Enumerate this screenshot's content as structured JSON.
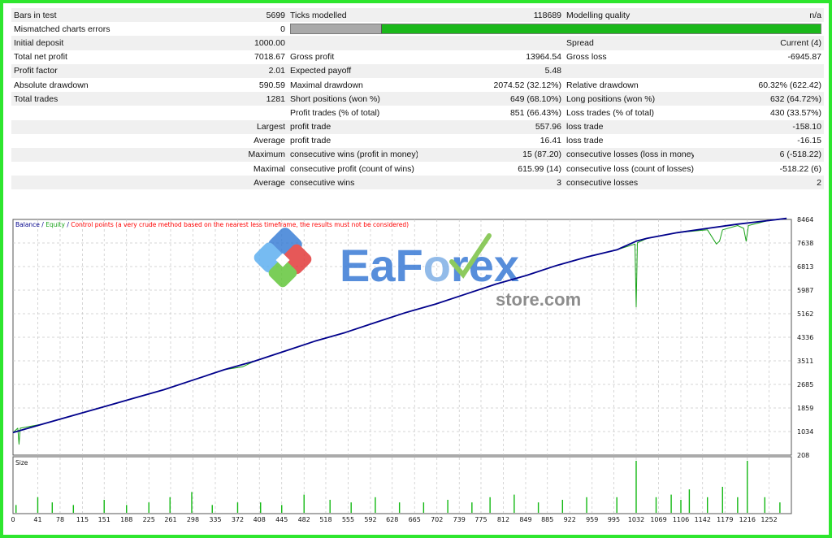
{
  "stats": [
    [
      {
        "label": "Bars in test",
        "value": "5699"
      },
      {
        "label": "Ticks modelled",
        "value": "118689"
      },
      {
        "label": "Modelling quality",
        "value": "n/a"
      }
    ],
    [
      {
        "label": "Mismatched charts errors",
        "value": "0"
      },
      null,
      null
    ],
    [
      {
        "label": "Initial deposit",
        "value": "1000.00"
      },
      null,
      {
        "label": "Spread",
        "value": "Current (4)"
      }
    ],
    [
      {
        "label": "Total net profit",
        "value": "7018.67"
      },
      {
        "label": "Gross profit",
        "value": "13964.54"
      },
      {
        "label": "Gross loss",
        "value": "-6945.87"
      }
    ],
    [
      {
        "label": "Profit factor",
        "value": "2.01"
      },
      {
        "label": "Expected payoff",
        "value": "5.48"
      },
      null
    ],
    [
      {
        "label": "Absolute drawdown",
        "value": "590.59"
      },
      {
        "label": "Maximal drawdown",
        "value": "2074.52 (32.12%)"
      },
      {
        "label": "Relative drawdown",
        "value": "60.32% (622.42)"
      }
    ],
    [
      {
        "label": "Total trades",
        "value": "1281"
      },
      {
        "label": "Short positions (won %)",
        "value": "649 (68.10%)"
      },
      {
        "label": "Long positions (won %)",
        "value": "632 (64.72%)"
      }
    ],
    [
      {
        "label": "",
        "value": ""
      },
      {
        "label": "Profit trades (% of total)",
        "value": "851 (66.43%)"
      },
      {
        "label": "Loss trades (% of total)",
        "value": "430 (33.57%)"
      }
    ],
    [
      {
        "label": "",
        "value": "Largest"
      },
      {
        "label": "profit trade",
        "value": "557.96"
      },
      {
        "label": "loss trade",
        "value": "-158.10"
      }
    ],
    [
      {
        "label": "",
        "value": "Average"
      },
      {
        "label": "profit trade",
        "value": "16.41"
      },
      {
        "label": "loss trade",
        "value": "-16.15"
      }
    ],
    [
      {
        "label": "",
        "value": "Maximum"
      },
      {
        "label": "consecutive wins (profit in money)",
        "value": "15 (87.20)"
      },
      {
        "label": "consecutive losses (loss in money)",
        "value": "6 (-518.22)"
      }
    ],
    [
      {
        "label": "",
        "value": "Maximal"
      },
      {
        "label": "consecutive profit (count of wins)",
        "value": "615.99 (14)"
      },
      {
        "label": "consecutive loss (count of losses)",
        "value": "-518.22 (6)"
      }
    ],
    [
      {
        "label": "",
        "value": "Average"
      },
      {
        "label": "consecutive wins",
        "value": "3"
      },
      {
        "label": "consecutive losses",
        "value": "2"
      }
    ]
  ],
  "quality_bar": {
    "fraction_gray": 0.17
  },
  "watermark": {
    "main_blue": "EaF",
    "main_o": "o",
    "main_rest": "rex",
    "sub": "store.com"
  },
  "colors": {
    "balance": "#00008b",
    "equity": "#1aa31a",
    "control": "#ff0000",
    "size_bars": "#12b812",
    "grid": "#c6c6c6"
  },
  "chart_data": {
    "type": "line",
    "legend": {
      "balance": "Balance",
      "sep1": " / ",
      "equity": "Equity",
      "sep2": " / ",
      "control": "Control points (a very crude method based on the nearest less timeframe, the results must not be considered)"
    },
    "ylim": [
      208,
      8464
    ],
    "y_ticks": [
      "8464",
      "7638",
      "6813",
      "5987",
      "5162",
      "4336",
      "3511",
      "2685",
      "1859",
      "1034",
      "208"
    ],
    "xlim": [
      0,
      1289
    ],
    "x_ticks": [
      "0",
      "41",
      "78",
      "115",
      "151",
      "188",
      "225",
      "261",
      "298",
      "335",
      "372",
      "408",
      "445",
      "482",
      "518",
      "555",
      "592",
      "628",
      "665",
      "702",
      "739",
      "775",
      "812",
      "849",
      "885",
      "922",
      "959",
      "995",
      "1032",
      "1069",
      "1106",
      "1142",
      "1179",
      "1216",
      "1252"
    ],
    "series": [
      {
        "name": "Balance",
        "x": [
          0,
          50,
          100,
          150,
          200,
          250,
          300,
          350,
          400,
          450,
          500,
          550,
          600,
          650,
          700,
          750,
          800,
          850,
          900,
          950,
          1000,
          1032,
          1050,
          1100,
          1150,
          1200,
          1250,
          1281
        ],
        "y": [
          1000,
          1300,
          1600,
          1900,
          2200,
          2500,
          2850,
          3200,
          3500,
          3850,
          4200,
          4500,
          4850,
          5200,
          5500,
          5850,
          6200,
          6500,
          6850,
          7150,
          7400,
          7700,
          7800,
          8000,
          8150,
          8300,
          8420,
          8500
        ]
      },
      {
        "name": "Equity",
        "x": [
          0,
          8,
          10,
          12,
          50,
          100,
          150,
          200,
          250,
          300,
          350,
          380,
          400,
          450,
          500,
          550,
          600,
          650,
          700,
          750,
          800,
          850,
          900,
          950,
          1000,
          1030,
          1032,
          1034,
          1040,
          1050,
          1100,
          1150,
          1165,
          1170,
          1175,
          1200,
          1210,
          1214,
          1218,
          1250,
          1281
        ],
        "y": [
          1000,
          1150,
          590,
          1150,
          1300,
          1600,
          1900,
          2200,
          2500,
          2850,
          3200,
          3300,
          3500,
          3850,
          4200,
          4500,
          4850,
          5200,
          5500,
          5850,
          6200,
          6500,
          6850,
          7150,
          7400,
          7600,
          5400,
          7650,
          7700,
          7800,
          8000,
          8100,
          7600,
          7700,
          8100,
          8250,
          8150,
          7700,
          8250,
          8420,
          8500
        ]
      }
    ],
    "size_panel": {
      "title": "Size",
      "x": [
        5,
        41,
        65,
        100,
        151,
        188,
        225,
        260,
        296,
        330,
        372,
        410,
        445,
        482,
        525,
        560,
        600,
        640,
        680,
        720,
        760,
        790,
        830,
        870,
        910,
        950,
        1000,
        1032,
        1065,
        1090,
        1106,
        1120,
        1150,
        1175,
        1200,
        1216,
        1245,
        1270
      ],
      "values": [
        0.15,
        0.3,
        0.2,
        0.15,
        0.25,
        0.15,
        0.2,
        0.3,
        0.4,
        0.15,
        0.2,
        0.2,
        0.15,
        0.35,
        0.25,
        0.2,
        0.3,
        0.2,
        0.2,
        0.25,
        0.2,
        0.3,
        0.35,
        0.2,
        0.25,
        0.3,
        0.3,
        1.0,
        0.3,
        0.35,
        0.25,
        0.45,
        0.3,
        0.5,
        0.3,
        1.0,
        0.3,
        0.2
      ]
    }
  }
}
